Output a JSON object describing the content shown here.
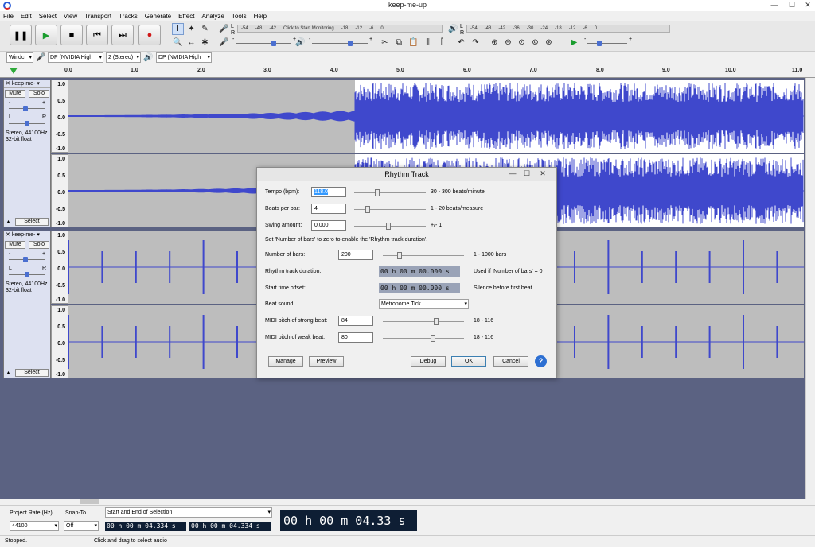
{
  "window": {
    "title": "keep-me-up",
    "min_icon": "minimize-icon",
    "max_icon": "maximize-icon",
    "close_icon": "close-icon"
  },
  "menu": [
    "File",
    "Edit",
    "Select",
    "View",
    "Transport",
    "Tracks",
    "Generate",
    "Effect",
    "Analyze",
    "Tools",
    "Help"
  ],
  "transport": {
    "pause": "❚❚",
    "play": "▶",
    "stop": "■",
    "skip_start": "⏮",
    "skip_end": "⏭",
    "record": "●"
  },
  "tools": {
    "select": "I",
    "envelope": "✦",
    "draw": "✎",
    "zoom": "🔍",
    "timeshift": "↔",
    "multi": "✱"
  },
  "meters": {
    "record": {
      "L": "L",
      "R": "R",
      "ticks": [
        "-54",
        "-48",
        "-42",
        "Click to Start Monitoring",
        "-18",
        "-12",
        "-6",
        "0"
      ]
    },
    "playback": {
      "L": "L",
      "R": "R",
      "ticks": [
        "-54",
        "-48",
        "-42",
        "-36",
        "-30",
        "-24",
        "-18",
        "-12",
        "-6",
        "0"
      ]
    }
  },
  "mixer": {
    "minus": "-",
    "plus": "+"
  },
  "devices": {
    "host": "Windc",
    "rec_device": "DP (NVIDIA High",
    "channels": "2 (Stereo)",
    "play_device": "DP (NVIDIA High"
  },
  "ruler": [
    "0.0",
    "1.0",
    "2.0",
    "3.0",
    "4.0",
    "5.0",
    "6.0",
    "7.0",
    "8.0",
    "9.0",
    "10.0",
    "11.0"
  ],
  "tracks": [
    {
      "name": "keep-me-",
      "mute": "Mute",
      "solo": "Solo",
      "gain_minus": "-",
      "gain_plus": "+",
      "pan_l": "L",
      "pan_r": "R",
      "rate": "Stereo, 44100Hz",
      "format": "32-bit float",
      "select": "Select",
      "scale": [
        "1.0",
        "0.5",
        "0.0",
        "-0.5",
        "-1.0"
      ]
    },
    {
      "name": "keep-me-",
      "mute": "Mute",
      "solo": "Solo",
      "gain_minus": "-",
      "gain_plus": "+",
      "pan_l": "L",
      "pan_r": "R",
      "rate": "Stereo, 44100Hz",
      "format": "32-bit float",
      "select": "Select",
      "scale": [
        "1.0",
        "0.5",
        "0.0",
        "-0.5",
        "-1.0"
      ]
    }
  ],
  "dialog": {
    "title": "Rhythm Track",
    "tempo_label": "Tempo (bpm):",
    "tempo": "118.0",
    "tempo_range": "30 - 300 beats/minute",
    "bpb_label": "Beats per bar:",
    "bpb": "4",
    "bpb_range": "1 - 20 beats/measure",
    "swing_label": "Swing amount:",
    "swing": "0.000",
    "swing_range": "+/- 1",
    "note": "Set 'Number of bars' to zero to enable the 'Rhythm track duration'.",
    "bars_label": "Number of bars:",
    "bars": "200",
    "bars_range": "1 - 1000 bars",
    "duration_label": "Rhythm track duration:",
    "duration": "00 h 00 m 00.000 s",
    "duration_note": "Used if 'Number of bars' = 0",
    "offset_label": "Start time offset:",
    "offset": "00 h 00 m 00.000 s",
    "offset_note": "Silence before first beat",
    "beat_label": "Beat sound:",
    "beat": "Metronome Tick",
    "strong_label": "MIDI pitch of strong beat:",
    "strong": "84",
    "strong_range": "18 - 116",
    "weak_label": "MIDI pitch of weak beat:",
    "weak": "80",
    "weak_range": "18 - 116",
    "manage": "Manage",
    "preview": "Preview",
    "debug": "Debug",
    "ok": "OK",
    "cancel": "Cancel",
    "help": "?"
  },
  "selection": {
    "rate_label": "Project Rate (Hz)",
    "rate": "44100",
    "snap_label": "Snap-To",
    "snap": "Off",
    "mode": "Start and End of Selection",
    "start": "00 h 00 m 04.334 s",
    "end": "00 h 00 m 04.334 s",
    "position": "00 h 00 m 04.33 s"
  },
  "status": {
    "state": "Stopped.",
    "hint": "Click and drag to select audio"
  },
  "colors": {
    "wave": "#3f48cc",
    "track_bg": "#5b6282",
    "timecode_bg": "#0e1e34"
  }
}
